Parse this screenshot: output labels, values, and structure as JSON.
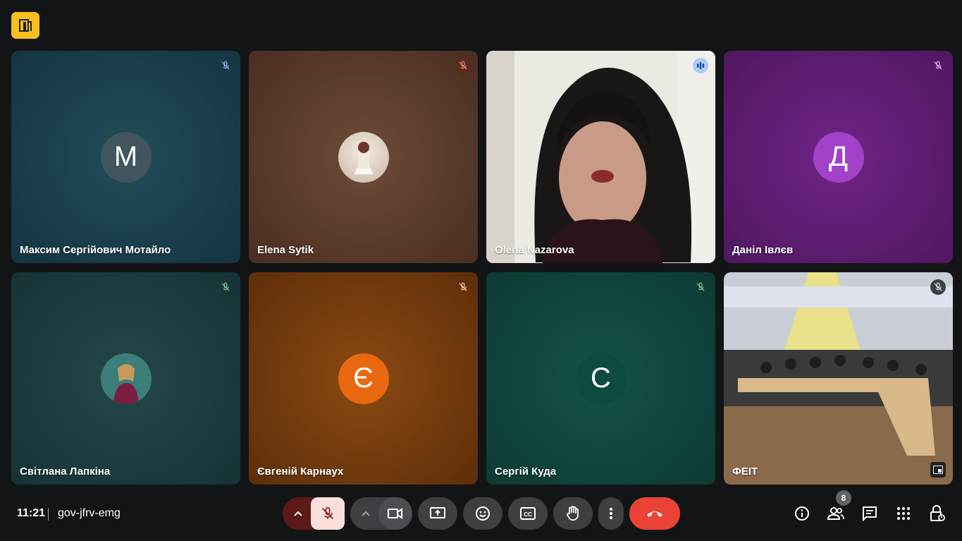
{
  "meeting": {
    "time": "11:21",
    "code": "gov-jfrv-emg",
    "participant_count": "8"
  },
  "tiles": [
    {
      "name": "Максим Сергійович Мотайло",
      "initial": "М",
      "bg": "#173c48",
      "avatar_bg": "#3c5560",
      "mic": "muted"
    },
    {
      "name": "Elena Sytik",
      "initial": "",
      "bg": "#5a3a2a",
      "avatar_bg": "#d8c8b8",
      "mic": "muted"
    },
    {
      "name": "Olena Nazarova",
      "initial": "",
      "bg": "#2a2220",
      "mic": "speaking"
    },
    {
      "name": "Даніл Івлєв",
      "initial": "Д",
      "bg": "#5c1d6e",
      "avatar_bg": "#a142c9",
      "mic": "muted"
    },
    {
      "name": "Світлана Лапкіна",
      "initial": "",
      "bg": "#1a3a3c",
      "avatar_bg": "#2c6b6a",
      "mic": "muted"
    },
    {
      "name": "Євгеній Карнаух",
      "initial": "Є",
      "bg": "#7a3e0f",
      "avatar_bg": "#e8690f",
      "mic": "muted"
    },
    {
      "name": "Сергій Куда",
      "initial": "С",
      "bg": "#0f3f37",
      "avatar_bg": "#0d4a3f",
      "mic": "muted"
    },
    {
      "name": "ФЕІТ",
      "initial": "",
      "bg": "#6b6256",
      "mic": "muted"
    }
  ],
  "controls": {
    "mic_state": "muted",
    "buttons": [
      "audio-options",
      "microphone",
      "video-options",
      "camera",
      "present-screen",
      "reactions",
      "captions",
      "raise-hand",
      "more-options",
      "leave-call"
    ]
  },
  "side_icons": [
    "meeting-details",
    "people",
    "chat",
    "activities",
    "host-controls"
  ],
  "colors": {
    "accent": "#f9bf1f",
    "leave": "#ea4335",
    "speaking": "#aecbfa",
    "mic_muted_bg": "#f9dedc",
    "mic_muted_dark": "#8c1d18"
  }
}
